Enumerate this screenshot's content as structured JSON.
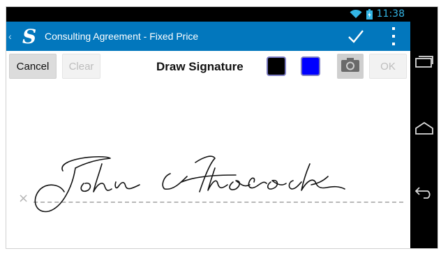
{
  "status_bar": {
    "time": "11:38",
    "wifi_icon": "wifi-icon",
    "battery_icon": "battery-icon",
    "accent": "#33b5e5"
  },
  "action_bar": {
    "title": "Consulting Agreement - Fixed Price",
    "logo_letter": "S",
    "background": "#0277bd",
    "check_icon": "check-icon",
    "overflow_icon": "overflow-menu-icon"
  },
  "toolbar": {
    "cancel_label": "Cancel",
    "clear_label": "Clear",
    "draw_label": "Draw Signature",
    "ok_label": "OK",
    "camera_icon": "camera-icon",
    "swatches": [
      {
        "name": "black",
        "color": "#000000"
      },
      {
        "name": "blue",
        "color": "#0000ff"
      }
    ]
  },
  "signature": {
    "x_mark": "×",
    "signed_name": "John Hancock"
  },
  "nav_bar": {
    "recent_icon": "recent-apps-icon",
    "home_icon": "home-icon",
    "back_icon": "back-icon"
  }
}
